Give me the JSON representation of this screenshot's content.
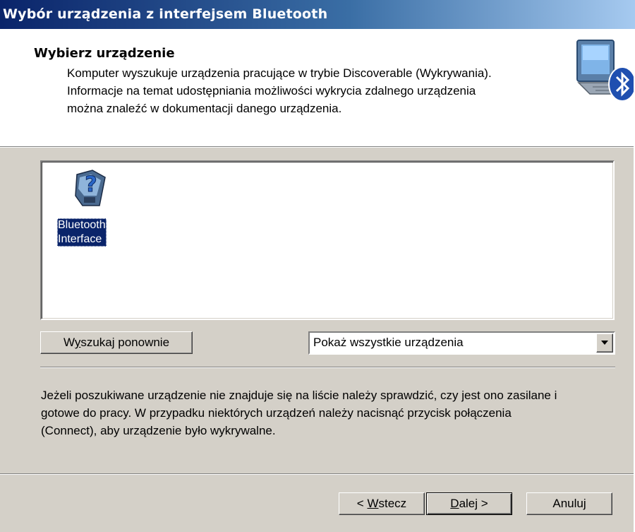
{
  "window": {
    "title": "Wybór urządzenia z interfejsem Bluetooth"
  },
  "header": {
    "title": "Wybierz urządzenie",
    "description_lines": [
      "Komputer wyszukuje urządzenia pracujące w trybie Discoverable (Wykrywania).",
      "Informacje na temat udostępniania możliwości wykrycia zdalnego urządzenia",
      "można znaleźć w dokumentacji danego urządzenia."
    ],
    "icon": "bluetooth-computer-icon"
  },
  "device_list": {
    "items": [
      {
        "label_line1": "Bluetooth",
        "label_line2": "Interface",
        "icon": "unknown-device-icon",
        "selected": true
      }
    ]
  },
  "controls": {
    "search_again_label_pre": "W",
    "search_again_label_accel": "y",
    "search_again_label_post": "szukaj ponownie",
    "filter_selected": "Pokaż wszystkie urządzenia"
  },
  "info": {
    "lines": [
      "Jeżeli poszukiwane urządzenie nie znajduje się na liście należy sprawdzić, czy jest ono zasilane i",
      "gotowe do pracy. W przypadku niektórych urządzeń należy nacisnąć przycisk połączenia",
      "(Connect), aby urządzenie było wykrywalne."
    ]
  },
  "footer": {
    "back_pre": "< ",
    "back_accel": "W",
    "back_post": "stecz",
    "next_accel": "D",
    "next_post": "alej >",
    "cancel_label": "Anuluj"
  },
  "colors": {
    "title_bar_start": "#0a246a",
    "title_bar_end": "#a6caf0",
    "dialog_face": "#d4d0c8",
    "selection": "#0a246a"
  }
}
